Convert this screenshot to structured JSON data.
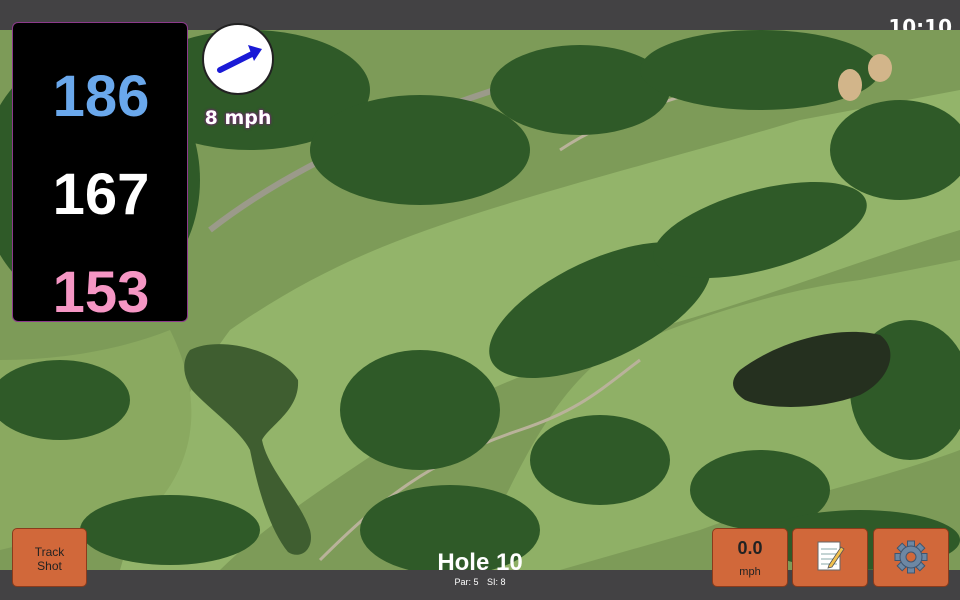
{
  "status": {
    "clock": "10:10"
  },
  "distances": {
    "back": "186",
    "middle": "167",
    "front": "153"
  },
  "wind": {
    "speed": "8 mph",
    "direction_icon": "arrow-icon"
  },
  "hole": {
    "title": "Hole 10",
    "par": "Par: 5",
    "si": "SI: 8"
  },
  "buttons": {
    "track_shot_line1": "Track",
    "track_shot_line2": "Shot",
    "speed_value": "0.0",
    "speed_unit": "mph",
    "notes_icon": "notepad-icon",
    "settings_icon": "gear-icon"
  },
  "colors": {
    "back_distance": "#6aa8ec",
    "middle_distance": "#ffffff",
    "front_distance": "#f596c4",
    "button_bg": "#d1683a",
    "wind_text_glow": "#7a1d7a"
  }
}
